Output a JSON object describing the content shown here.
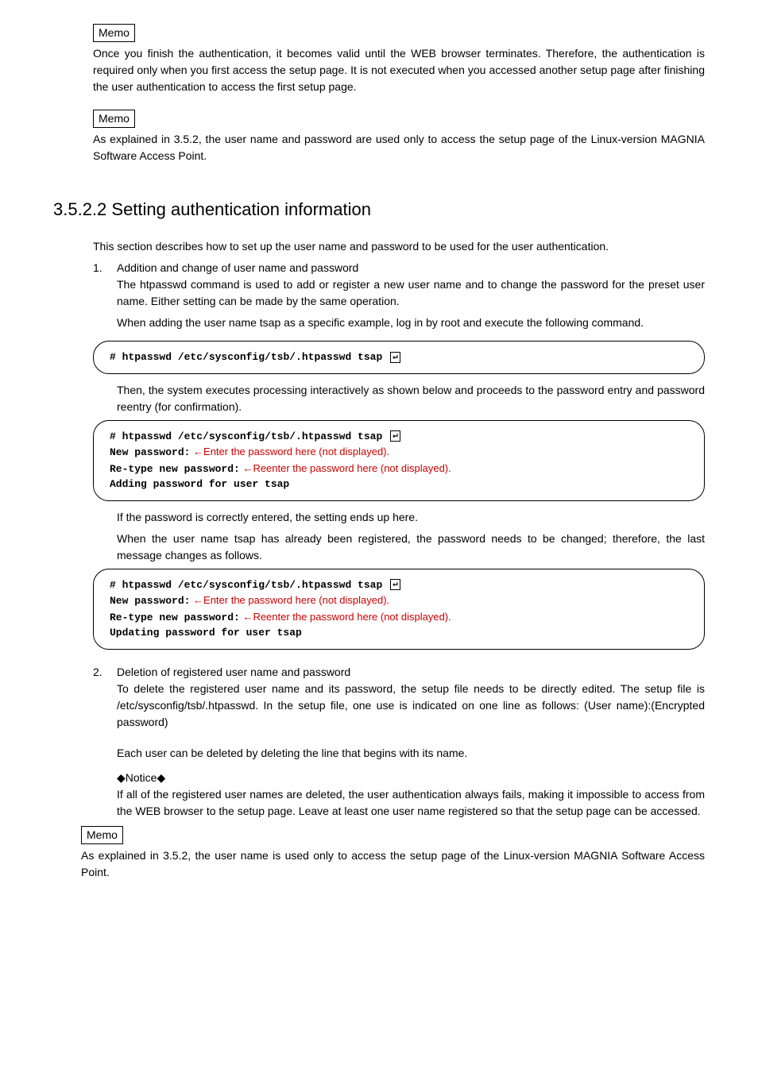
{
  "memo_label": "Memo",
  "memo1_text": "Once you finish the authentication, it becomes valid until the WEB browser terminates.   Therefore, the authentication is required only when you first access the setup page.   It is not executed when you accessed another setup page after finishing the user authentication to access the first setup page.",
  "memo2_text": "As explained in 3.5.2, the user name and password are used only to access the setup page of the Linux-version MAGNIA Software Access Point.",
  "heading": "3.5.2.2  Setting authentication information",
  "intro": "This section describes how to set up the user name and password to be used for the user authentication.",
  "item1_num": "1.",
  "item1_title": "Addition and change of user name and password",
  "item1_p1": "The htpasswd command is used to add or register a new user name and to change the password for the preset user name.   Either setting can be made by the same operation.",
  "item1_p2": "When adding the user name tsap as a specific example, log in by root and execute the following command.",
  "code1_hash": "# ",
  "code1_cmd": "htpasswd /etc/sysconfig/tsb/.htpasswd tsap",
  "enter": "↵",
  "item1_p3": "Then, the system executes processing interactively as shown below and proceeds to the password entry and password reentry (for confirmation).",
  "code2_l1_hash": "# ",
  "code2_l1_cmd": "htpasswd /etc/sysconfig/tsb/.htpasswd tsap",
  "code2_l2_pre": "New password:",
  "code2_l2_red": " ←Enter the password here (not displayed).",
  "code2_l3_pre": "Re-type new password:",
  "code2_l3_red": " ←Reenter the password here (not displayed).",
  "code2_l4": "Adding password for user tsap",
  "item1_p4": " If the password is correctly entered, the setting ends up here.",
  "item1_p5": "When the user name tsap has already been registered, the password needs to be changed; therefore, the last message changes as follows.",
  "code3_l1_hash": "# ",
  "code3_l1_cmd": "htpasswd /etc/sysconfig/tsb/.htpasswd tsap",
  "code3_l2_pre": "New password:",
  "code3_l2_red": " ←Enter the password here (not displayed).",
  "code3_l3_pre": "Re-type new password:",
  "code3_l3_red": " ←Reenter the password here (not displayed).",
  "code3_l4": "Updating password for user tsap",
  "item2_num": "2.",
  "item2_title": "Deletion of registered user name and password",
  "item2_p1": "To delete the registered user name and its password, the setup file needs to be directly edited.   The setup file is /etc/sysconfig/tsb/.htpasswd.   In the setup file, one use is indicated on one line as follows:       (User name):(Encrypted password)",
  "item2_p2": "Each user can be deleted by deleting the line that begins with its name.",
  "notice_label": "◆Notice◆",
  "notice_text": "If all of the registered user names are deleted, the user authentication always fails, making it impossible to access from the WEB browser to the setup page.   Leave at least one user name registered so that the setup page can be accessed.",
  "memo3_text": "As explained in 3.5.2, the user name is used only to access the setup page of the Linux-version MAGNIA Software Access Point."
}
